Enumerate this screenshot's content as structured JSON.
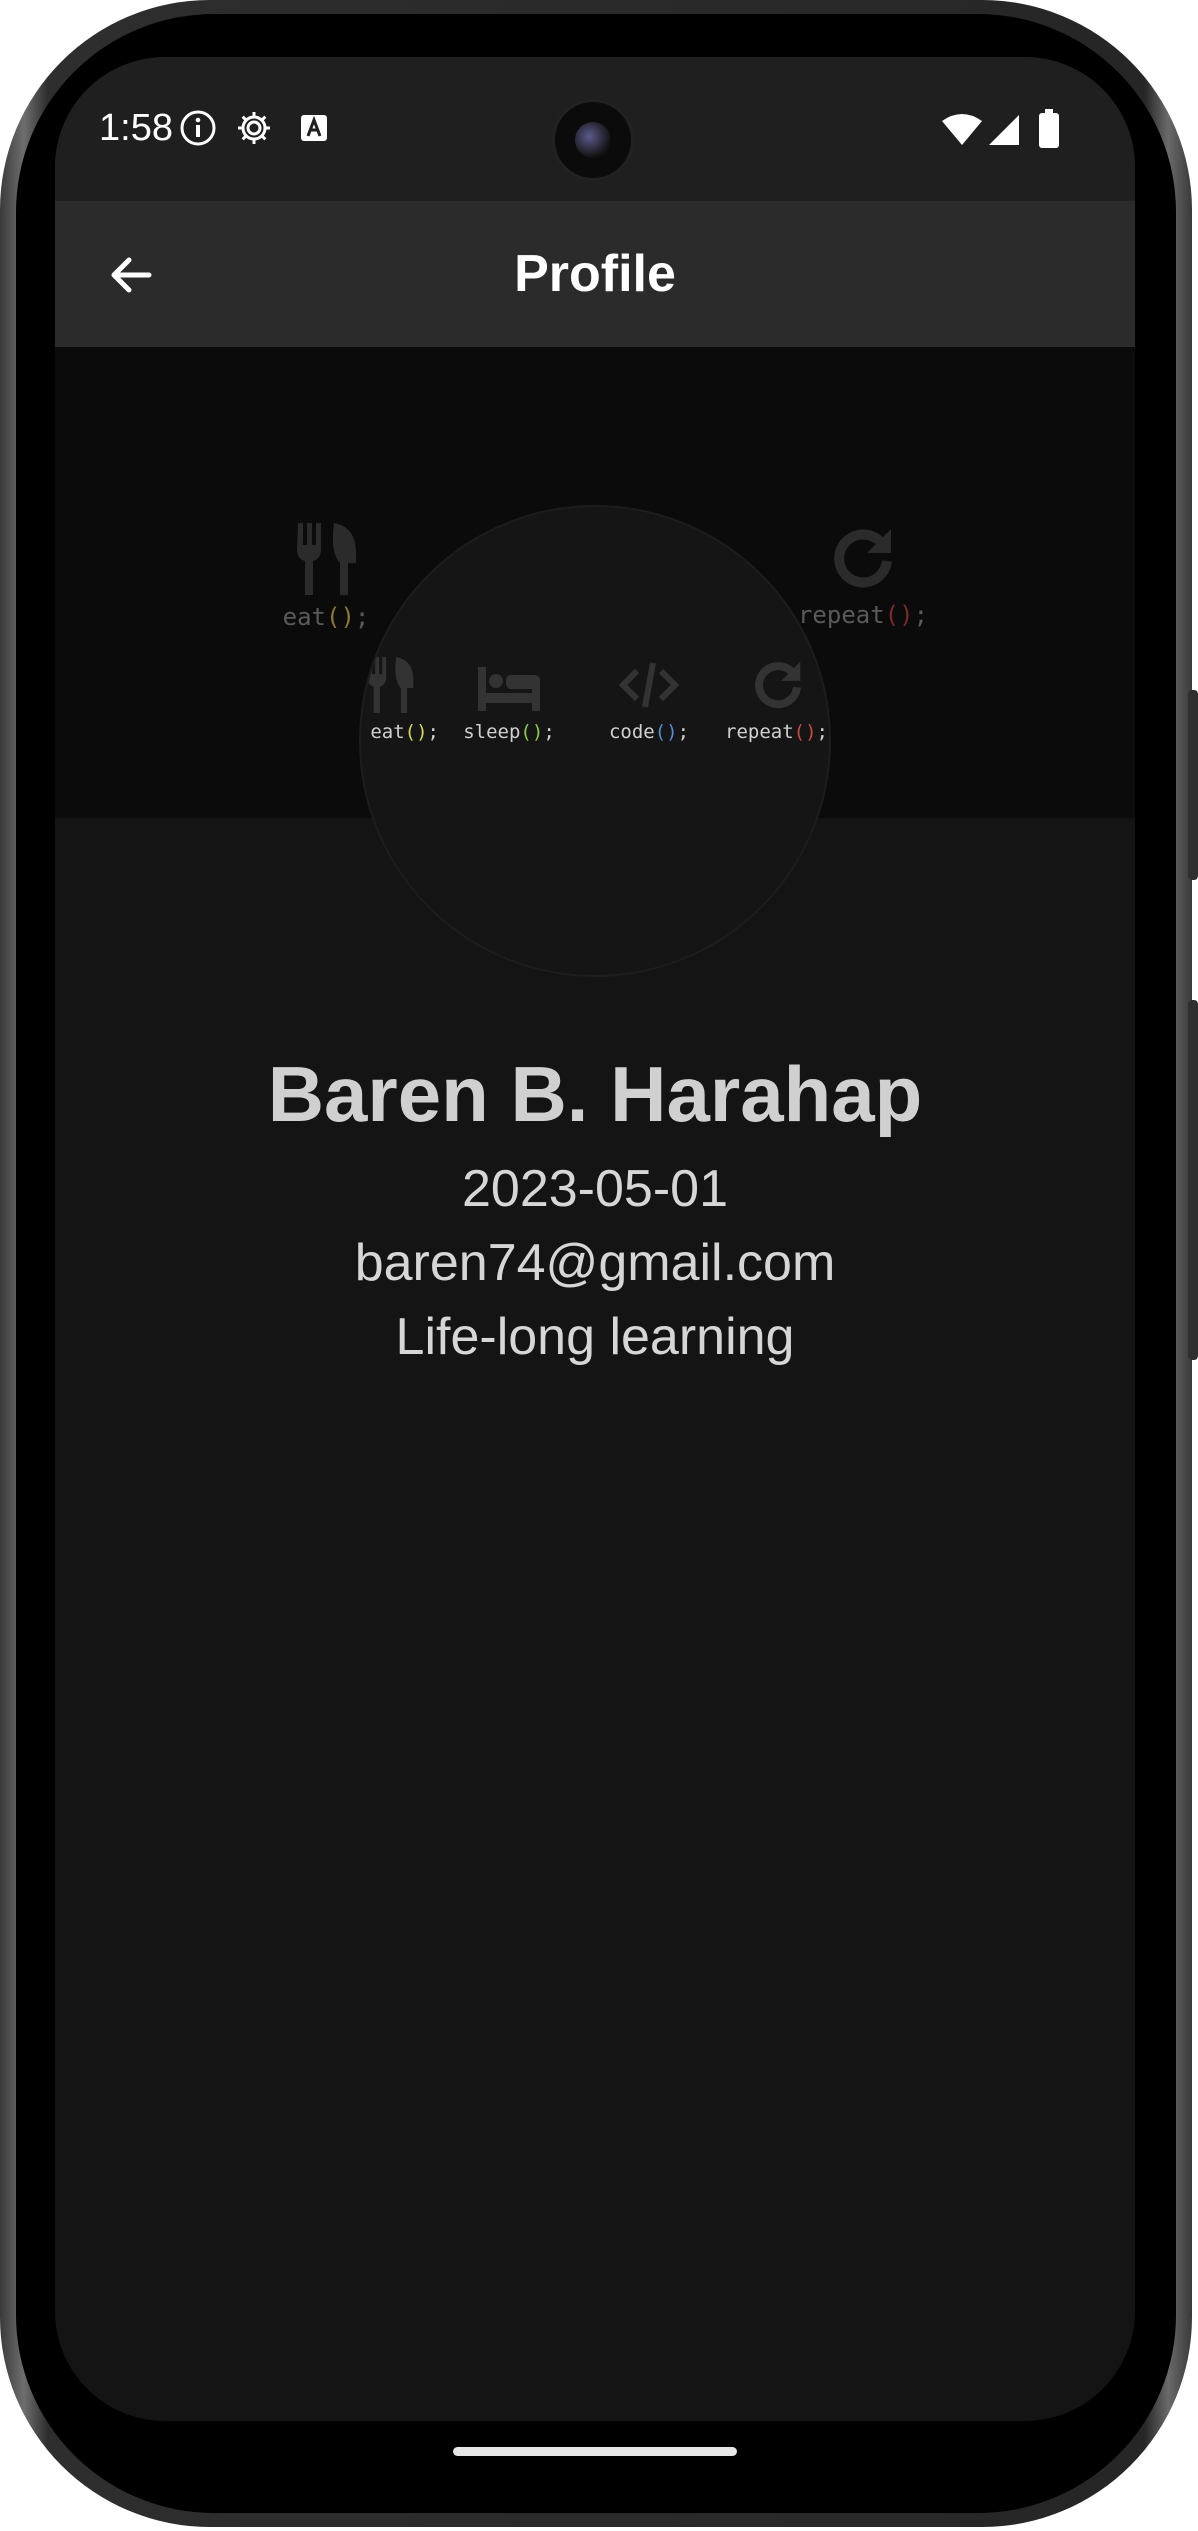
{
  "status_bar": {
    "time": "1:58",
    "icons": [
      "info-icon",
      "settings-icon",
      "font-a-icon",
      "wifi-icon",
      "cellular-signal-icon",
      "battery-icon"
    ]
  },
  "app_bar": {
    "title": "Profile",
    "back_icon": "arrow-back-icon"
  },
  "cover": {
    "large_items": [
      {
        "icon": "fork-knife-icon",
        "name": "eat",
        "parens": "()",
        "semicolon": ";",
        "color": "#9a8a3a"
      },
      {
        "icon": "repeat-icon",
        "name": "repeat",
        "parens": "()",
        "semicolon": ";",
        "color": "#8a3030"
      }
    ]
  },
  "avatar": {
    "items": [
      {
        "icon": "fork-knife-icon",
        "name": "eat",
        "parens": "()",
        "semicolon": ";",
        "color": "#d8d45a"
      },
      {
        "icon": "bed-icon",
        "name": "sleep",
        "parens": "()",
        "semicolon": ";",
        "color": "#8ec64a"
      },
      {
        "icon": "code-icon",
        "name": "code",
        "parens": "()",
        "semicolon": ";",
        "color": "#5a8ad6"
      },
      {
        "icon": "repeat-icon",
        "name": "repeat",
        "parens": "()",
        "semicolon": ";",
        "color": "#c84848"
      }
    ]
  },
  "profile": {
    "name": "Baren B. Harahap",
    "date": "2023-05-01",
    "email": "baren74@gmail.com",
    "bio": "Life-long learning"
  },
  "colors": {
    "screen_bg": "#141414",
    "status_bar_bg": "#1f1f1f",
    "app_bar_bg": "#2b2b2b",
    "cover_bg": "#0b0b0b",
    "title_text": "#ffffff",
    "profile_text": "#d0d0d0"
  }
}
